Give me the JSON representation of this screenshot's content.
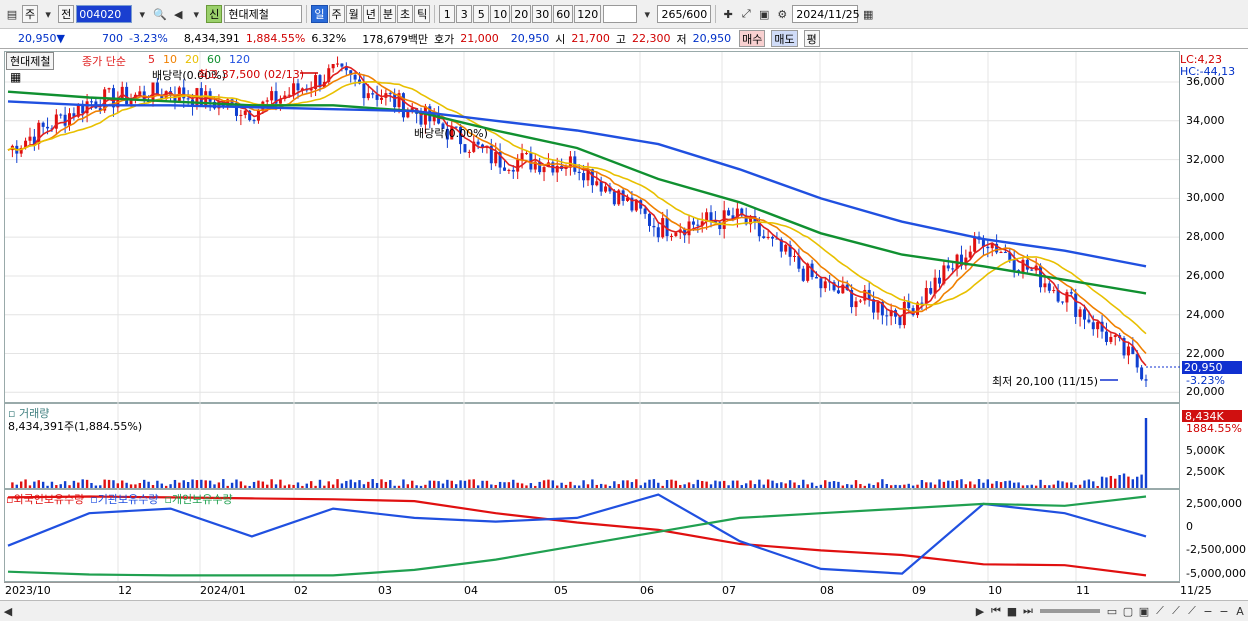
{
  "toolbar": {
    "type_label": "주",
    "market_label": "전",
    "code": "004020",
    "badge": "신",
    "name": "현대제철",
    "periods": [
      "일",
      "주",
      "월",
      "년",
      "분",
      "초",
      "틱"
    ],
    "active_period": "일",
    "minutes": [
      "1",
      "3",
      "5",
      "10",
      "20",
      "30",
      "60",
      "120"
    ],
    "count": "265",
    "count_max": "/600",
    "date": "2024/11/25"
  },
  "quote": {
    "price": "20,950",
    "arrow": "▼",
    "change": "700",
    "change_pct": "-3.23%",
    "volume": "8,434,391",
    "volume_pct": "1,884.55%",
    "turnover": "6.32%",
    "amount": "178,679백만",
    "ask_label": "호가",
    "ask": "21,000",
    "bid": "20,950",
    "open_label": "시",
    "open": "21,700",
    "high_label": "고",
    "high": "22,300",
    "low_label": "저",
    "low": "20,950",
    "buy_label": "매수",
    "sell_label": "매도",
    "eval_label": "평"
  },
  "price_panel": {
    "stock_label": "현대제철",
    "ma_title": "종가 단순",
    "ma_periods": [
      "5",
      "10",
      "20",
      "60",
      "120"
    ],
    "ma_colors": [
      "#e02020",
      "#f08000",
      "#e8c000",
      "#109030",
      "#2050e0"
    ],
    "lc": "LC:4,23",
    "hc": "HC:-44,13",
    "y_ticks": [
      "36,000",
      "34,000",
      "32,000",
      "30,000",
      "28,000",
      "26,000",
      "24,000",
      "22,000",
      "20,000"
    ],
    "y_range": [
      19500,
      37600
    ],
    "current_price": "20,950",
    "current_pct": "-3.23%",
    "annot_dividend1": "배당락(0.00%)",
    "annot_high": "최고 37,500 (02/13)",
    "annot_dividend2": "배당락(0.00%)",
    "annot_low": "최저 20,100 (11/15)"
  },
  "volume_panel": {
    "title": "거래량",
    "value": "8,434,391주(1,884.55%)",
    "badge": "8,434K",
    "badge_pct": "1884.55%",
    "y_ticks": [
      "5,000K",
      "2,500K"
    ]
  },
  "holding_panel": {
    "titles": [
      "외국인보유수량",
      "기관보유수량",
      "개인보유수량"
    ],
    "colors": [
      "#e01010",
      "#2050e0",
      "#20a050"
    ],
    "y_ticks": [
      "2,500,000",
      "0",
      "-2,500,000",
      "-5,000,000"
    ],
    "y_range": [
      -5800000,
      4000000
    ]
  },
  "x_axis": [
    "2023/10",
    "12",
    "2024/01",
    "02",
    "03",
    "04",
    "05",
    "06",
    "07",
    "08",
    "09",
    "10",
    "11",
    "11/25"
  ],
  "chart_data": {
    "type": "line",
    "x": [
      "2023/10",
      "2023/11",
      "2023/12",
      "2024/01",
      "2024/02",
      "2024/03",
      "2024/04",
      "2024/05",
      "2024/06",
      "2024/07",
      "2024/08",
      "2024/09",
      "2024/10",
      "2024/11",
      "2024/11/25"
    ],
    "series": [
      {
        "name": "종가",
        "values": [
          32500,
          35000,
          35500,
          34500,
          36500,
          34500,
          32000,
          31800,
          28500,
          29000,
          25500,
          24000,
          28000,
          25000,
          20950
        ]
      },
      {
        "name": "60",
        "values": [
          35500,
          35200,
          35000,
          34800,
          34800,
          34500,
          33500,
          32600,
          31000,
          29800,
          28200,
          27100,
          26500,
          25800,
          25100
        ]
      },
      {
        "name": "120",
        "values": [
          35000,
          34800,
          34800,
          34700,
          34600,
          34500,
          34000,
          33500,
          32800,
          31500,
          30000,
          28800,
          27900,
          27300,
          26500
        ]
      },
      {
        "name": "외국인보유수량",
        "values": [
          3200000,
          3300000,
          3200000,
          3100000,
          3000000,
          2800000,
          1500000,
          500000,
          -300000,
          -1800000,
          -2500000,
          -3000000,
          -4000000,
          -4100000,
          -5200000
        ]
      },
      {
        "name": "기관보유수량",
        "values": [
          -2000000,
          1500000,
          2000000,
          -1000000,
          2000000,
          1000000,
          600000,
          1000000,
          3500000,
          -1500000,
          -4500000,
          -5000000,
          2500000,
          1500000,
          -1000000
        ]
      },
      {
        "name": "개인보유수량",
        "values": [
          -4800000,
          -5100000,
          -5200000,
          -5200000,
          -5200000,
          -4600000,
          -3500000,
          -2000000,
          -500000,
          1000000,
          1500000,
          2000000,
          2500000,
          2300000,
          3300000
        ]
      }
    ],
    "volume_last": 8434391,
    "ylim": [
      19500,
      37600
    ]
  }
}
